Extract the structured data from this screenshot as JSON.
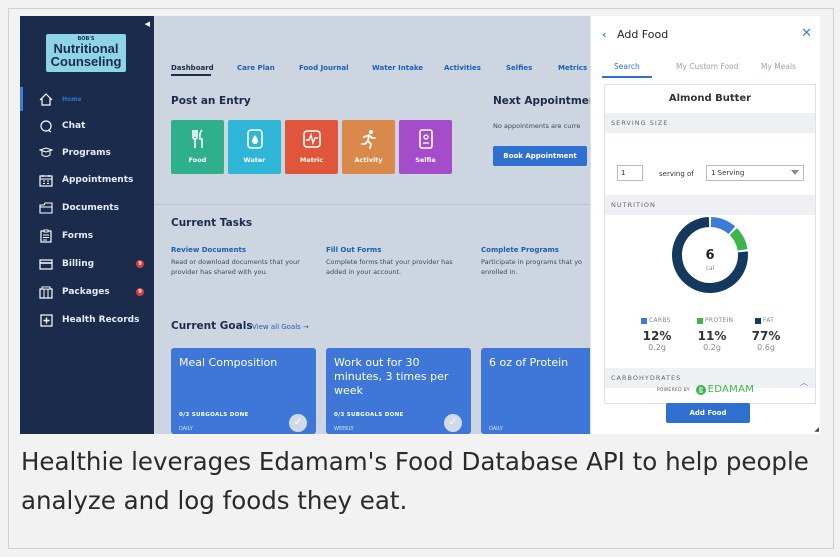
{
  "sidebar": {
    "logo": {
      "line1": "BOB'S",
      "line2": "Nutritional",
      "line3": "Counseling"
    },
    "items": [
      {
        "label": "Home"
      },
      {
        "label": "Chat"
      },
      {
        "label": "Programs"
      },
      {
        "label": "Appointments"
      },
      {
        "label": "Documents"
      },
      {
        "label": "Forms"
      },
      {
        "label": "Billing",
        "badge": "9"
      },
      {
        "label": "Packages",
        "badge": "9"
      },
      {
        "label": "Health Records"
      }
    ]
  },
  "main": {
    "tabs": [
      "Dashboard",
      "Care Plan",
      "Food Journal",
      "Water Intake",
      "Activities",
      "Selfies",
      "Metrics"
    ],
    "post_entry": {
      "title": "Post an Entry",
      "tiles": [
        {
          "label": "Food",
          "color": "#2fb08c"
        },
        {
          "label": "Water",
          "color": "#2fb6d6"
        },
        {
          "label": "Metric",
          "color": "#e0563a"
        },
        {
          "label": "Activity",
          "color": "#d98a4b"
        },
        {
          "label": "Selfie",
          "color": "#a44cc9"
        }
      ]
    },
    "next_appointment": {
      "title": "Next Appointment",
      "text": "No appointments are curre",
      "button": "Book Appointment"
    },
    "current_tasks": {
      "title": "Current Tasks",
      "tasks": [
        {
          "title": "Review Documents",
          "desc1": "Read or download documents that your",
          "desc2": "provider has shared with you."
        },
        {
          "title": "Fill Out Forms",
          "desc1": "Complete forms that your provider has",
          "desc2": "added in your account."
        },
        {
          "title": "Complete Programs",
          "desc1": "Participate in programs that yo",
          "desc2": "enrolled in."
        }
      ]
    },
    "current_goals": {
      "title": "Current Goals",
      "link": "View all Goals →",
      "goals": [
        {
          "title": "Meal Composition",
          "subgoals": "0/3 SUBGOALS DONE",
          "freq": "DAILY"
        },
        {
          "title": "Work out for 30 minutes, 3 times per week",
          "subgoals": "0/3 SUBGOALS DONE",
          "freq": "WEEKLY"
        },
        {
          "title": "6 oz of Protein",
          "subgoals": "",
          "freq": "DAILY"
        }
      ]
    }
  },
  "panel": {
    "title": "Add Food",
    "tabs": [
      "Search",
      "My Custom Food",
      "My Meals"
    ],
    "food_name": "Almond Butter",
    "serving_size_label": "SERVING SIZE",
    "quantity": "1",
    "serving_of": "serving of",
    "unit": "1 Serving",
    "nutrition_label": "NUTRITION",
    "calories": "6",
    "cal_unit": "cal",
    "macros": [
      {
        "name": "CARBS",
        "pct": "12%",
        "grams": "0.2g",
        "fraction": 0.12,
        "color": "#3d7bd9"
      },
      {
        "name": "PROTEIN",
        "pct": "11%",
        "grams": "0.2g",
        "fraction": 0.11,
        "color": "#3db54a"
      },
      {
        "name": "FAT",
        "pct": "77%",
        "grams": "0.6g",
        "fraction": 0.77,
        "color": "#14395e"
      }
    ],
    "carbohydrates_label": "CARBOHYDRATES",
    "powered_by": "POWERED BY",
    "edamam": "EDAMAM",
    "add_button": "Add Food"
  },
  "caption": "Healthie leverages Edamam's Food Database API to help people analyze and log foods they eat."
}
